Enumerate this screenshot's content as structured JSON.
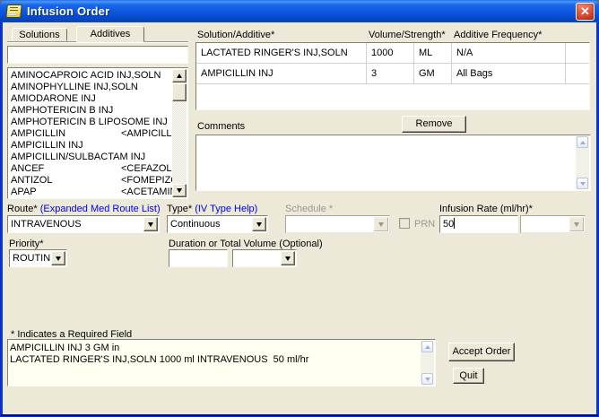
{
  "window": {
    "title": "Infusion Order",
    "close_glyph": "✕"
  },
  "tabs": [
    {
      "label": "Solutions",
      "active": false
    },
    {
      "label": "Additives",
      "active": true
    }
  ],
  "filter": {
    "value": ""
  },
  "med_list": {
    "items": [
      {
        "name": "AMINOCAPROIC ACID INJ,SOLN",
        "synonym": ""
      },
      {
        "name": "AMINOPHYLLINE INJ,SOLN",
        "synonym": ""
      },
      {
        "name": "AMIODARONE INJ",
        "synonym": ""
      },
      {
        "name": "AMPHOTERICIN B INJ",
        "synonym": ""
      },
      {
        "name": "AMPHOTERICIN B LIPOSOME INJ",
        "synonym": ""
      },
      {
        "name": "AMPICILLIN",
        "synonym": "<AMPICILLIN"
      },
      {
        "name": "AMPICILLIN INJ",
        "synonym": ""
      },
      {
        "name": "AMPICILLIN/SULBACTAM INJ",
        "synonym": ""
      },
      {
        "name": "ANCEF",
        "synonym": "<CEFAZOLIN"
      },
      {
        "name": "ANTIZOL",
        "synonym": "<FOMEPIZO"
      },
      {
        "name": "APAP",
        "synonym": "<ACETAMIN"
      }
    ]
  },
  "order_table": {
    "headers": [
      "Solution/Additive*",
      "Volume/Strength*",
      "Additive Frequency*"
    ],
    "rows": [
      {
        "solution": "LACTATED RINGER'S INJ,SOLN",
        "volume": "1000",
        "unit": "ML",
        "frequency": "N/A"
      },
      {
        "solution": "AMPICILLIN INJ",
        "volume": "3",
        "unit": "GM",
        "frequency": "All Bags"
      }
    ]
  },
  "buttons": {
    "remove": "Remove",
    "accept": "Accept Order",
    "quit": "Quit"
  },
  "comments": {
    "label": "Comments",
    "value": ""
  },
  "fields": {
    "route": {
      "label": "Route*",
      "link": "(Expanded Med Route List)",
      "value": "INTRAVENOUS"
    },
    "iv_type": {
      "label": "Type*",
      "link": "(IV Type Help)",
      "value": "Continuous"
    },
    "schedule": {
      "label": "Schedule *",
      "value": "",
      "prn_label": "PRN"
    },
    "infusion_rate": {
      "label": "Infusion Rate (ml/hr)*",
      "value": "50",
      "unit_value": ""
    },
    "priority": {
      "label": "Priority*",
      "value": "ROUTINE"
    },
    "duration": {
      "label": "Duration or Total Volume (Optional)",
      "value": "",
      "unit_value": ""
    }
  },
  "footer": {
    "required_note": "* Indicates a Required Field",
    "summary_lines": [
      "AMPICILLIN INJ 3 GM in",
      "LACTATED RINGER'S INJ,SOLN 1000 ml INTRAVENOUS  50 ml/hr"
    ]
  },
  "colors": {
    "dialog_bg": "#ece9d8",
    "titlebar_blue": "#0951d8",
    "border_blue": "#0a37da",
    "close_red": "#d14328",
    "link_blue": "#0000f0",
    "disabled_gray": "#9a988c",
    "summary_bg": "#fffff2"
  }
}
